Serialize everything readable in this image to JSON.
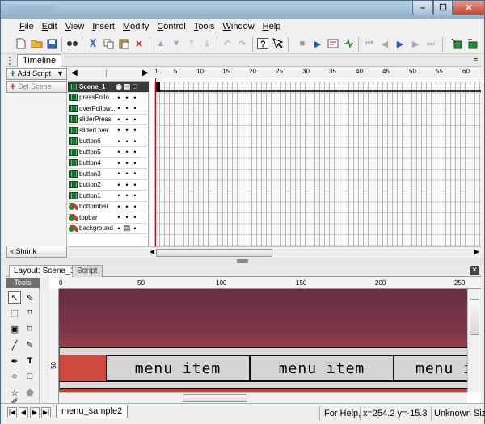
{
  "menubar": [
    "File",
    "Edit",
    "View",
    "Insert",
    "Modify",
    "Control",
    "Tools",
    "Window",
    "Help"
  ],
  "timeline": {
    "tab_label": "Timeline",
    "add_script": "Add Script",
    "del_scene": "Del Scene",
    "shrink": "Shrink",
    "layers": [
      "Scene_1",
      "pressFollo...",
      "overFollow...",
      "sliderPress",
      "sliderOver",
      "button6",
      "button5",
      "button4",
      "button3",
      "button2",
      "button1",
      "bottombar",
      "topbar",
      "background"
    ],
    "ruler_ticks": [
      "1",
      "5",
      "10",
      "15",
      "20",
      "25",
      "30",
      "35",
      "40",
      "45",
      "50",
      "55",
      "60"
    ]
  },
  "layout": {
    "tab_layout": "Layout: Scene_1",
    "tab_script": "Script",
    "tools_label": "Tools",
    "ruler_h": [
      "0",
      "50",
      "100",
      "150",
      "200",
      "250"
    ],
    "ruler_v": [
      "50"
    ],
    "menu_items": [
      "menu item",
      "menu item",
      "menu item"
    ],
    "colors": {
      "stage_top": "#6a2c46",
      "stage_bottom": "#b84436",
      "menu_band": "#d4d4d4"
    }
  },
  "status": {
    "doc_tab": "menu_sample2",
    "help": "For Help,",
    "coords": "x=254.2 y=-15.3",
    "size": "Unknown Size"
  }
}
